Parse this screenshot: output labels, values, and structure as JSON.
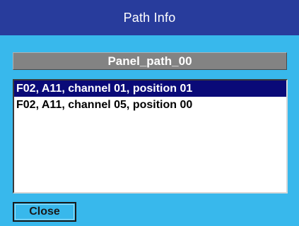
{
  "window": {
    "title": "Path Info"
  },
  "path": {
    "name": "Panel_path_00"
  },
  "list": {
    "items": [
      {
        "label": "F02, A11, channel 01, position 01",
        "selected": true
      },
      {
        "label": "F02, A11, channel 05, position 00",
        "selected": false
      }
    ]
  },
  "buttons": {
    "close_label": "Close"
  },
  "colors": {
    "background": "#38b8ec",
    "titlebar": "#283c9c",
    "header": "#838383",
    "selection": "#0a0a78"
  }
}
